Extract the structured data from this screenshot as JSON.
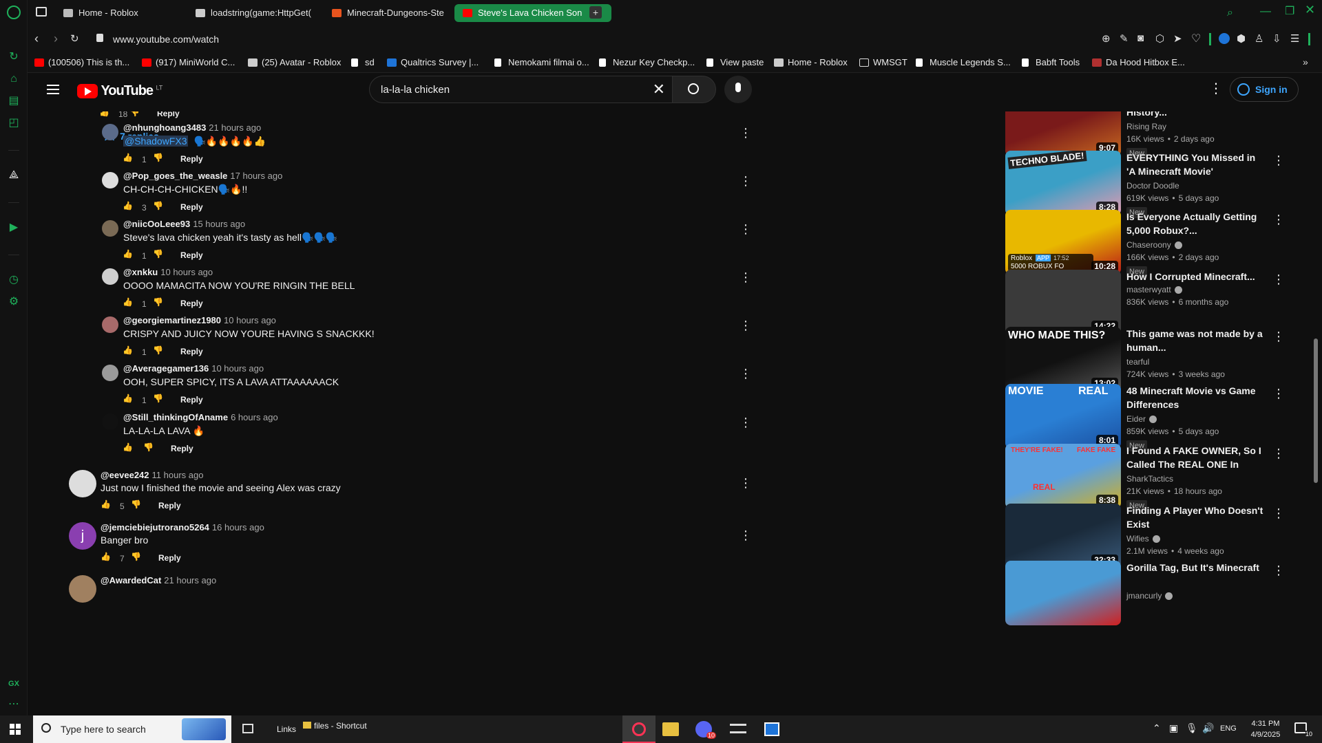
{
  "browser": {
    "tabs": [
      {
        "label": "Home - Roblox",
        "active": false,
        "color": "#bbbbbb"
      },
      {
        "label": "loadstring(game:HttpGet(",
        "active": false,
        "color": "#cccccc"
      },
      {
        "label": "Minecraft-Dungeons-Ste",
        "active": false,
        "color": "#e8541e"
      },
      {
        "label": "Steve's Lava Chicken Son",
        "active": true,
        "color": "#ff0000"
      }
    ],
    "url": "www.youtube.com/watch",
    "bookmarks": [
      {
        "label": "(100506) This is th...",
        "icon": "youtube-icon"
      },
      {
        "label": "(917) MiniWorld C...",
        "icon": "youtube-icon"
      },
      {
        "label": "(25) Avatar - Roblox",
        "icon": "roblox-icon"
      },
      {
        "label": "sd",
        "icon": "page-icon"
      },
      {
        "label": "Qualtrics Survey |...",
        "icon": "qualtrics-icon"
      },
      {
        "label": "Nemokami filmai o...",
        "icon": "page-icon"
      },
      {
        "label": "Nezur Key Checkp...",
        "icon": "page-icon"
      },
      {
        "label": "View paste",
        "icon": "page-icon"
      },
      {
        "label": "Home - Roblox",
        "icon": "roblox-icon"
      },
      {
        "label": "WMSGT",
        "icon": "folder-icon"
      },
      {
        "label": "Muscle Legends S...",
        "icon": "page-icon"
      },
      {
        "label": "Babft Tools",
        "icon": "page-icon"
      },
      {
        "label": "Da Hood Hitbox E...",
        "icon": "grid-icon"
      }
    ]
  },
  "youtube": {
    "logo": "YouTube",
    "region": "LT",
    "search_value": "la-la-la chicken",
    "sign_in": "Sign in",
    "prev_likes": "18",
    "reply_label": "Reply",
    "replies_toggle": "7 replies",
    "replies": [
      {
        "author": "@nhunghoang3483",
        "ago": "21 hours ago",
        "mention": "@ShadowFX3",
        "text": "🗣️🔥🔥🔥🔥👍",
        "likes": "1",
        "avatar": "#5b6b8a"
      },
      {
        "author": "@Pop_goes_the_weasle",
        "ago": "17 hours ago",
        "mention": "",
        "text": "CH-CH-CH-CHICKEN🗣️🔥!!",
        "likes": "3",
        "avatar": "#dddddd"
      },
      {
        "author": "@niicOoLeee93",
        "ago": "15 hours ago",
        "mention": "",
        "text": "Steve's lava chicken yeah it's tasty as hell🗣️🗣️🗣️",
        "likes": "1",
        "avatar": "#7a6a55"
      },
      {
        "author": "@xnkku",
        "ago": "10 hours ago",
        "mention": "",
        "text": "OOOO MAMACITA NOW YOU'RE RINGIN THE BELL",
        "likes": "1",
        "avatar": "#cfcfcf"
      },
      {
        "author": "@georgiemartinez1980",
        "ago": "10 hours ago",
        "mention": "",
        "text": "CRISPY AND JUICY NOW YOURE HAVING S SNACKKK!",
        "likes": "1",
        "avatar": "#a86a6a"
      },
      {
        "author": "@Averagegamer136",
        "ago": "10 hours ago",
        "mention": "",
        "text": "OOH, SUPER SPICY, ITS A LAVA ATTAAAAAACK",
        "likes": "1",
        "avatar": "#9a9a9a"
      },
      {
        "author": "@Still_thinkingOfAname",
        "ago": "6 hours ago",
        "mention": "",
        "text": "LA-LA-LA LAVA 🔥",
        "likes": "",
        "avatar": "#111111"
      }
    ],
    "comments": [
      {
        "author": "@eevee242",
        "ago": "11 hours ago",
        "text": "Just now I finished the movie and seeing Alex was crazy",
        "likes": "5",
        "avatar": "#dddddd",
        "initial": ""
      },
      {
        "author": "@jemciebiejutrorano5264",
        "ago": "16 hours ago",
        "text": "Banger bro",
        "likes": "7",
        "avatar": "#8a3fb0",
        "initial": "j"
      },
      {
        "author": "@AwardedCat",
        "ago": "21 hours ago",
        "text": "",
        "likes": "",
        "avatar": "#a08060",
        "initial": ""
      }
    ],
    "recommendations": [
      {
        "title": "The Darkest Day in Roblox History...",
        "channel": "Rising Ray",
        "views": "16K views",
        "age": "2 days ago",
        "duration": "9:07",
        "badge": "New",
        "verified": false,
        "thumb": "#7a1a1a",
        "thumb2": "#c86a20"
      },
      {
        "title": "EVERYTHING You Missed in 'A Minecraft Movie'",
        "channel": "Doctor Doodle",
        "views": "619K views",
        "age": "5 days ago",
        "duration": "8:28",
        "badge": "New",
        "verified": false,
        "thumb": "#3b9fc6",
        "thumb2": "#e69bb0"
      },
      {
        "title": "Is Everyone Actually Getting 5,000 Robux?...",
        "channel": "Chaseroony",
        "views": "166K views",
        "age": "2 days ago",
        "duration": "10:28",
        "badge": "New",
        "verified": true,
        "thumb": "#e8b800",
        "thumb2": "#b81818"
      },
      {
        "title": "How I Corrupted Minecraft...",
        "channel": "masterwyatt",
        "views": "836K views",
        "age": "6 months ago",
        "duration": "14:22",
        "badge": "",
        "verified": true,
        "thumb": "#3a3a3a",
        "thumb2": "#3a3a3a"
      },
      {
        "title": "This game was not made by a human...",
        "channel": "tearful",
        "views": "724K views",
        "age": "3 weeks ago",
        "duration": "13:02",
        "badge": "",
        "verified": false,
        "thumb": "#111111",
        "thumb2": "#555555"
      },
      {
        "title": "48 Minecraft Movie vs Game Differences",
        "channel": "Eider",
        "views": "859K views",
        "age": "5 days ago",
        "duration": "8:01",
        "badge": "New",
        "verified": true,
        "thumb": "#2a7fd4",
        "thumb2": "#1a4fa0"
      },
      {
        "title": "I Found A FAKE OWNER, So I Called The REAL ONE In Roblo...",
        "channel": "SharkTactics",
        "views": "21K views",
        "age": "18 hours ago",
        "duration": "8:38",
        "badge": "New",
        "verified": false,
        "thumb": "#5aa0e0",
        "thumb2": "#d4b020"
      },
      {
        "title": "Finding A Player Who Doesn't Exist",
        "channel": "Wifies",
        "views": "2.1M views",
        "age": "4 weeks ago",
        "duration": "32:33",
        "badge": "",
        "verified": true,
        "thumb": "#1a2a3a",
        "thumb2": "#3a5a7a"
      },
      {
        "title": "Gorilla Tag, But It's Minecraft",
        "channel": "jmancurly",
        "views": "",
        "age": "",
        "duration": "",
        "badge": "",
        "verified": true,
        "thumb": "#4a9ad4",
        "thumb2": "#d02020"
      }
    ],
    "thumb_text": {
      "techno": "TECHNO BLADE!",
      "roblox_app": "Roblox",
      "app_badge": "APP",
      "app_time": "17:52",
      "robux_caption": "5000 ROBUX FO",
      "who_made": "WHO MADE THIS?",
      "movie": "MOVIE",
      "real": "REAL",
      "fake1": "THEY'RE FAKE!",
      "fake2": "FAKE FAKE",
      "fake3": "REAL"
    }
  },
  "taskbar": {
    "search_placeholder": "Type here to search",
    "links": "Links",
    "shortcut": "files - Shortcut",
    "lang": "ENG",
    "time": "4:31 PM",
    "date": "4/9/2025",
    "notif_count": "10",
    "discord_badge": "10"
  },
  "colors": {
    "accent": "#1a8a47",
    "yt_red": "#ff0000",
    "bg": "#0f0f0f"
  }
}
